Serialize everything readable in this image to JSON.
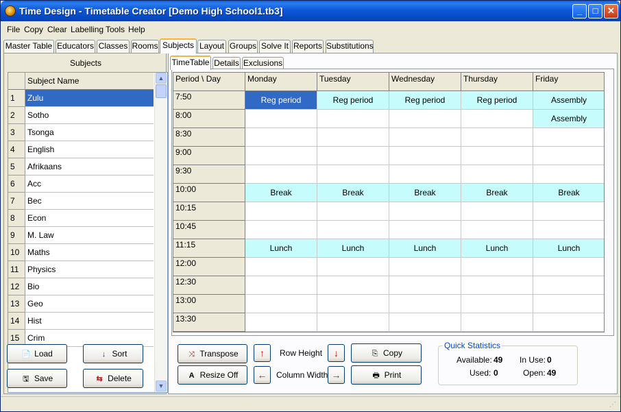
{
  "window": {
    "title": "Time Design - Timetable Creator [Demo High School1.tb3]"
  },
  "menu": [
    "File",
    "Copy",
    "Clear",
    "Labelling",
    "Tools",
    "Help"
  ],
  "main_tabs": [
    "Master Table",
    "Educators",
    "Classes",
    "Rooms",
    "Subjects",
    "Layout",
    "Groups",
    "Solve It",
    "Reports",
    "Substitutions"
  ],
  "main_tab_active": "Subjects",
  "subjects_panel": {
    "title": "Subjects",
    "column_header": "Subject Name",
    "rows": [
      {
        "num": "1",
        "name": "Zulu"
      },
      {
        "num": "2",
        "name": "Sotho"
      },
      {
        "num": "3",
        "name": "Tsonga"
      },
      {
        "num": "4",
        "name": "English"
      },
      {
        "num": "5",
        "name": "Afrikaans"
      },
      {
        "num": "6",
        "name": "Acc"
      },
      {
        "num": "7",
        "name": "Bec"
      },
      {
        "num": "8",
        "name": "Econ"
      },
      {
        "num": "9",
        "name": "M. Law"
      },
      {
        "num": "10",
        "name": "Maths"
      },
      {
        "num": "11",
        "name": "Physics"
      },
      {
        "num": "12",
        "name": "Bio"
      },
      {
        "num": "13",
        "name": "Geo"
      },
      {
        "num": "14",
        "name": "Hist"
      },
      {
        "num": "15",
        "name": "Crim"
      }
    ],
    "selected_row": "1",
    "buttons": {
      "load": "Load",
      "sort": "Sort",
      "save": "Save",
      "delete": "Delete"
    }
  },
  "sub_tabs": [
    "TimeTable",
    "Details",
    "Exclusions"
  ],
  "sub_tab_active": "TimeTable",
  "timetable": {
    "corner": "Period \\ Day",
    "days": [
      "Monday",
      "Tuesday",
      "Wednesday",
      "Thursday",
      "Friday"
    ],
    "periods": [
      "7:50",
      "8:00",
      "8:30",
      "9:00",
      "9:30",
      "10:00",
      "10:15",
      "10:45",
      "11:15",
      "12:00",
      "12:30",
      "13:00",
      "13:30"
    ],
    "cells": [
      [
        "Reg period",
        "Reg period",
        "Reg period",
        "Reg period",
        "Assembly"
      ],
      [
        "",
        "",
        "",
        "",
        "Assembly"
      ],
      [
        "",
        "",
        "",
        "",
        ""
      ],
      [
        "",
        "",
        "",
        "",
        ""
      ],
      [
        "",
        "",
        "",
        "",
        ""
      ],
      [
        "Break",
        "Break",
        "Break",
        "Break",
        "Break"
      ],
      [
        "",
        "",
        "",
        "",
        ""
      ],
      [
        "",
        "",
        "",
        "",
        ""
      ],
      [
        "Lunch",
        "Lunch",
        "Lunch",
        "Lunch",
        "Lunch"
      ],
      [
        "",
        "",
        "",
        "",
        ""
      ],
      [
        "",
        "",
        "",
        "",
        ""
      ],
      [
        "",
        "",
        "",
        "",
        ""
      ],
      [
        "",
        "",
        "",
        "",
        ""
      ]
    ],
    "selected_cell": "Monday 7:50",
    "colors": {
      "filled": "#c6fdfc",
      "selected": "#316ac5"
    }
  },
  "controls": {
    "transpose": "Transpose",
    "resize_off": "Resize Off",
    "row_height": "Row Height",
    "column_width": "Column Width",
    "copy": "Copy",
    "print": "Print"
  },
  "quick_stats": {
    "title": "Quick Statistics",
    "available_label": "Available:",
    "available": "49",
    "in_use_label": "In Use:",
    "in_use": "0",
    "used_label": "Used:",
    "used": "0",
    "open_label": "Open:",
    "open": "49"
  }
}
